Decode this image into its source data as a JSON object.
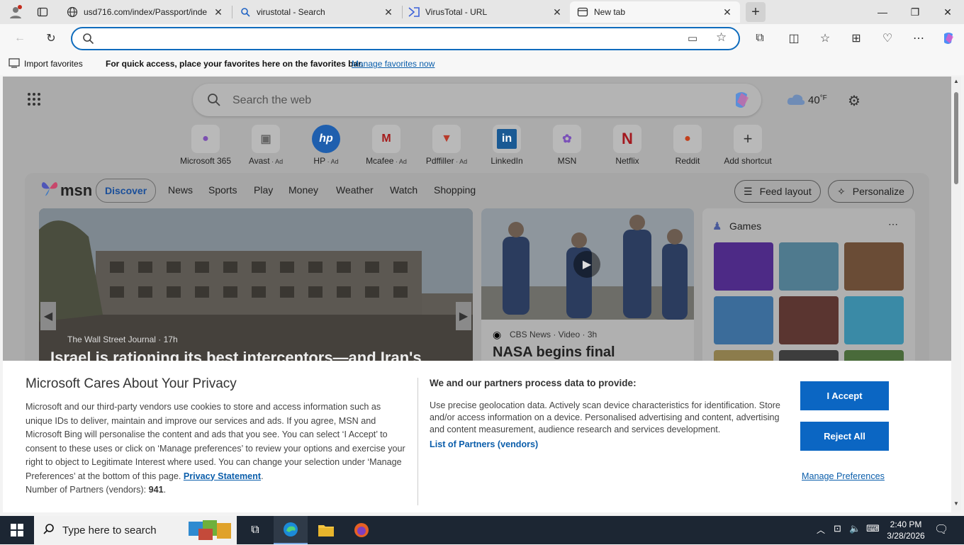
{
  "tabs": [
    {
      "title": "usd716.com/index/Passport/inde",
      "icon": "globe-icon"
    },
    {
      "title": "virustotal - Search",
      "icon": "search-icon"
    },
    {
      "title": "VirusTotal - URL",
      "icon": "virustotal-icon"
    },
    {
      "title": "New tab",
      "icon": "newtab-icon"
    }
  ],
  "address": {
    "value": "",
    "placeholder": ""
  },
  "favbar": {
    "import_label": "Import favorites",
    "message": "For quick access, place your favorites here on the favorites bar.",
    "manage_link": "Manage favorites now"
  },
  "newtab": {
    "search_placeholder": "Search the web",
    "weather": "40",
    "weather_unit": "°F",
    "shortcuts": [
      {
        "label": "Microsoft 365",
        "ad": ""
      },
      {
        "label": "Avast",
        "ad": " · Ad"
      },
      {
        "label": "HP",
        "ad": " · Ad"
      },
      {
        "label": "Mcafee",
        "ad": " · Ad"
      },
      {
        "label": "Pdffiller",
        "ad": " · Ad"
      },
      {
        "label": "LinkedIn",
        "ad": ""
      },
      {
        "label": "MSN",
        "ad": ""
      },
      {
        "label": "Netflix",
        "ad": ""
      },
      {
        "label": "Reddit",
        "ad": ""
      },
      {
        "label": "Add shortcut",
        "ad": ""
      }
    ]
  },
  "feed": {
    "brand": "msn",
    "nav": [
      "Discover",
      "News",
      "Sports",
      "Play",
      "Money",
      "Weather",
      "Watch",
      "Shopping"
    ],
    "feed_layout": "Feed layout",
    "personalize": "Personalize",
    "hero": {
      "source": "The Wall Street Journal · 17h",
      "headline": "Israel is rationing its best interceptors—and Iran's"
    },
    "video": {
      "source": "CBS News · Video · 3h",
      "headline": "NASA begins final"
    },
    "games_title": "Games"
  },
  "consent": {
    "title": "Microsoft Cares About Your Privacy",
    "body": "Microsoft and our third-party vendors use cookies to store and access information such as unique IDs to deliver, maintain and improve our services and ads. If you agree, MSN and Microsoft Bing will personalise the content and ads that you see. You can select ‘I Accept’ to consent to these uses or click on ‘Manage preferences’ to review your options and exercise your right to object to Legitimate Interest where used.  You can change your selection under ‘Manage Preferences’ at the bottom of this page. ",
    "privacy_link": "Privacy Statement",
    "partners_prefix": "Number of Partners (vendors): ",
    "partners_count": "941",
    "purposes_title": "We and our partners process data to provide:",
    "purposes": "Use precise geolocation data. Actively scan device characteristics for identification. Store and/or access information on a device. Personalised advertising and content, advertising and content measurement, audience research and services development.",
    "partners_link": "List of Partners (vendors)",
    "accept": "I Accept",
    "reject": "Reject All",
    "manage": "Manage Preferences"
  },
  "taskbar": {
    "search_placeholder": "Type here to search",
    "time": "2:40 PM",
    "date": "3/28/2026"
  },
  "colors": {
    "accent": "#0b66c3",
    "taskbar": "#1c2633",
    "address_border": "#0f6cbd"
  }
}
